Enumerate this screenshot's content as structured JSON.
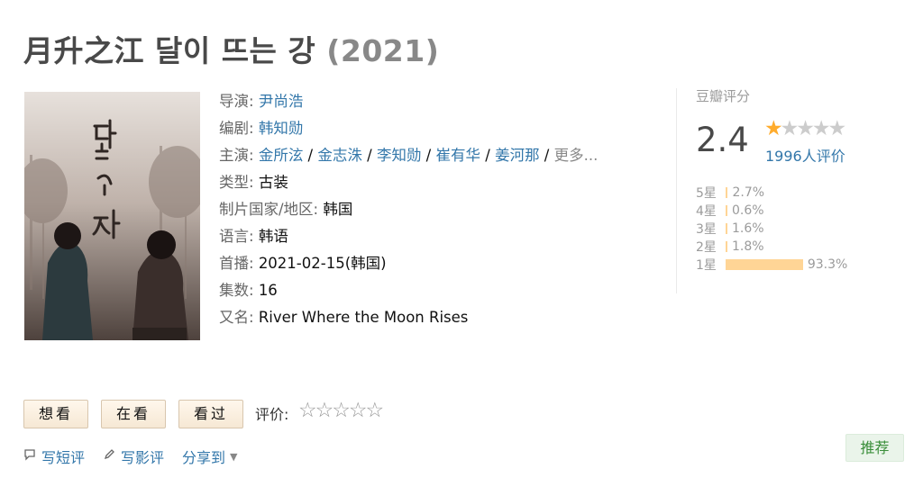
{
  "title": {
    "main": "月升之江 달이 뜨는 강",
    "year": "(2021)"
  },
  "info": {
    "director": {
      "label": "导演:",
      "value": "尹尚浩"
    },
    "writer": {
      "label": "编剧:",
      "value": "韩知勋"
    },
    "cast": {
      "label": "主演:",
      "names": [
        "金所泫",
        "金志洙",
        "李知勋",
        "崔有华",
        "姜河那"
      ],
      "sep": " / ",
      "more": "更多..."
    },
    "genre": {
      "label": "类型:",
      "value": "古装"
    },
    "country": {
      "label": "制片国家/地区:",
      "value": "韩国"
    },
    "language": {
      "label": "语言:",
      "value": "韩语"
    },
    "premiere": {
      "label": "首播:",
      "value": "2021-02-15(韩国)"
    },
    "episodes": {
      "label": "集数:",
      "value": "16"
    },
    "aka": {
      "label": "又名:",
      "value": "River Where the Moon Rises"
    }
  },
  "rating": {
    "header": "豆瓣评分",
    "score": "2.4",
    "stars_filled": 1,
    "stars_total": 5,
    "people": "1996人评价",
    "distribution": [
      {
        "label": "5星",
        "pct": "2.7%",
        "value": 2.7
      },
      {
        "label": "4星",
        "pct": "0.6%",
        "value": 0.6
      },
      {
        "label": "3星",
        "pct": "1.6%",
        "value": 1.6
      },
      {
        "label": "2星",
        "pct": "1.8%",
        "value": 1.8
      },
      {
        "label": "1星",
        "pct": "93.3%",
        "value": 93.3
      }
    ]
  },
  "buttons": {
    "want": "想看",
    "watching": "在看",
    "watched": "看过"
  },
  "my_rating": {
    "label": "评价:"
  },
  "actions": {
    "short_review": "写短评",
    "review": "写影评",
    "share": "分享到"
  },
  "recommend": "推荐",
  "colors": {
    "link": "#3377aa",
    "star": "#ffac2d",
    "bar": "#ffd596",
    "recommend_bg": "#eaf4ea"
  }
}
